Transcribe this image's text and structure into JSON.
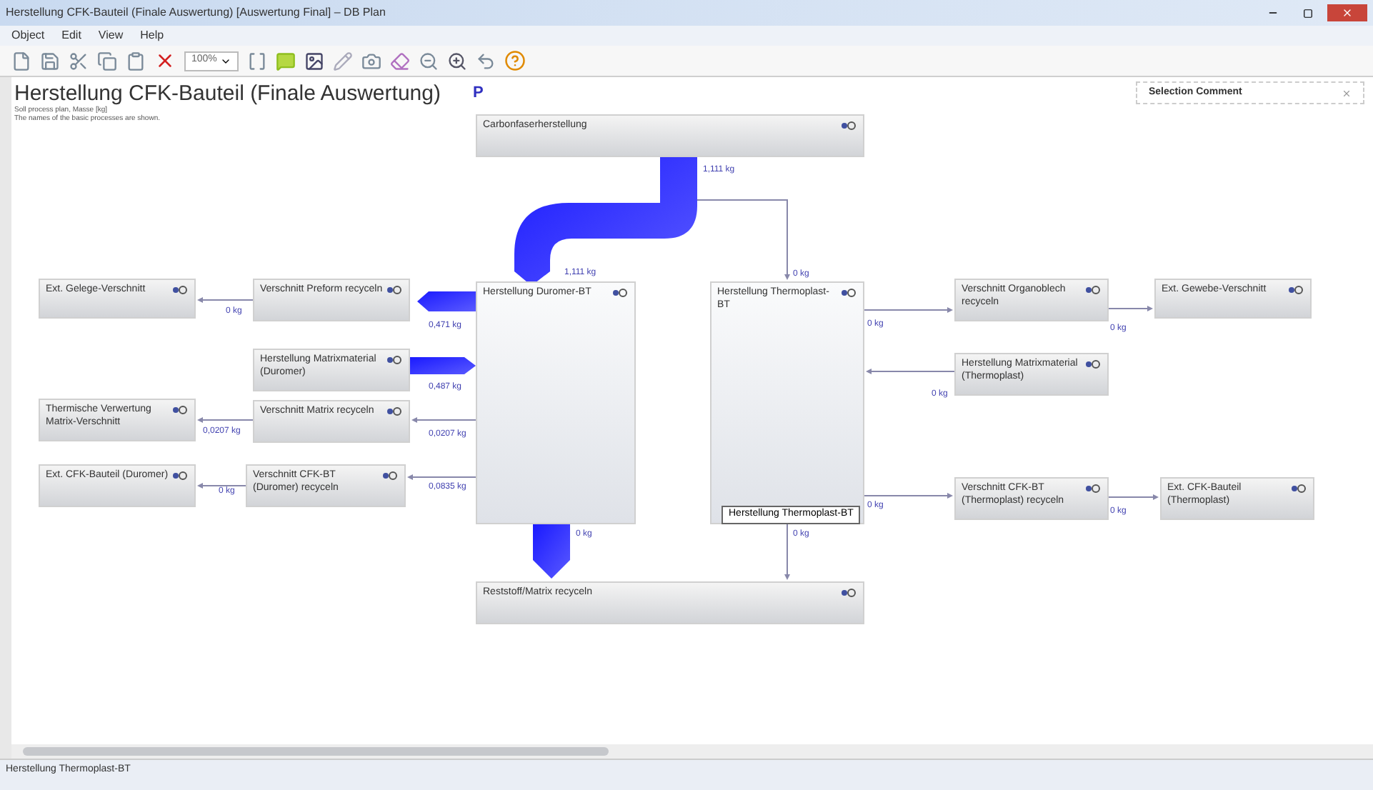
{
  "window": {
    "title": "Herstellung CFK-Bauteil (Finale Auswertung) [Auswertung Final] – DB Plan"
  },
  "menu": [
    "Object",
    "Edit",
    "View",
    "Help"
  ],
  "toolbar": {
    "zoom": "100%"
  },
  "diagram": {
    "title": "Herstellung CFK-Bauteil (Finale Auswertung)",
    "subtitle": [
      "Soll process plan, Masse [kg]",
      "The names of the basic processes are shown."
    ],
    "marker": "P",
    "nodes": [
      {
        "label": "Carbonfaserherstellung"
      },
      {
        "label": "Ext. Gelege-Verschnitt"
      },
      {
        "label": "Verschnitt Preform recyceln"
      },
      {
        "label": "Herstellung Duromer-BT"
      },
      {
        "label": "Herstellung Thermoplast-BT"
      },
      {
        "label": "Verschnitt Organoblech recyceln"
      },
      {
        "label": "Ext. Gewebe-Verschnitt"
      },
      {
        "label": "Herstellung Matrixmaterial (Duromer)"
      },
      {
        "label": "Herstellung Matrixmaterial (Thermoplast)"
      },
      {
        "label": "Thermische Verwertung Matrix-Verschnitt"
      },
      {
        "label": "Verschnitt Matrix recyceln"
      },
      {
        "label": "Ext. CFK-Bauteil (Duromer)"
      },
      {
        "label": "Verschnitt CFK-BT (Duromer) recyceln"
      },
      {
        "label": "Verschnitt CFK-BT (Thermoplast) recyceln"
      },
      {
        "label": "Ext. CFK-Bauteil (Thermoplast)"
      },
      {
        "label": "Reststoff/Matrix recyceln"
      }
    ],
    "flow_labels": [
      "1,111 kg",
      "1,111 kg",
      "0 kg",
      "0 kg",
      "0,471 kg",
      "0,487 kg",
      "0,0207 kg",
      "0,0207 kg",
      "0 kg",
      "0,0835 kg",
      "0 kg",
      "0 kg",
      "0 kg",
      "0 kg",
      "0 kg",
      "0 kg",
      "0 kg"
    ],
    "tooltip": "Herstellung Thermoplast-BT"
  },
  "selection_panel": {
    "title": "Selection Comment"
  },
  "status_bar": "Herstellung Thermoplast-BT"
}
